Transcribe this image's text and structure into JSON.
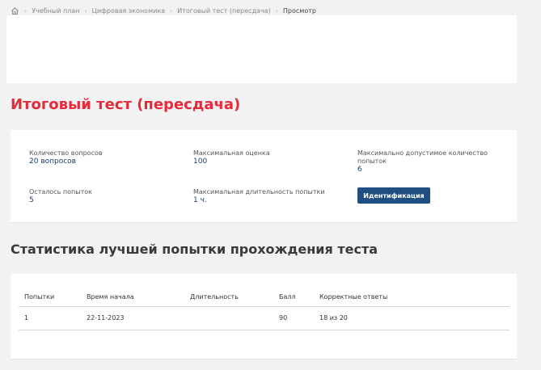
{
  "breadcrumb": {
    "items": [
      "Учебный план",
      "Цифровая экономика",
      "Итоговый тест (пересдача)",
      "Просмотр"
    ]
  },
  "page": {
    "title": "Итоговый тест (пересдача)"
  },
  "info": {
    "questions_count_label": "Количество вопросов",
    "questions_count_value": "20 вопросов",
    "max_score_label": "Максимальная оценка",
    "max_score_value": "100",
    "max_attempts_label": "Максимально допустимое количество попыток",
    "max_attempts_value": "6",
    "attempts_left_label": "Осталось попыток",
    "attempts_left_value": "5",
    "max_duration_label": "Максимальная длительность попытки",
    "max_duration_value": "1 ч.",
    "identify_button": "Идентификация"
  },
  "stats": {
    "title": "Статистика лучшей попытки прохождения теста",
    "columns": [
      "Попытки",
      "Время начала",
      "Длительность",
      "Балл",
      "Корректные ответы"
    ],
    "rows": [
      [
        "1",
        "22-11-2023",
        "",
        "90",
        "18 из 20"
      ]
    ]
  },
  "colors": {
    "title_red": "#e52a3c",
    "button_blue": "#1e4f80",
    "value_blue": "#1a3d6b",
    "background": "#f2f2f2"
  }
}
